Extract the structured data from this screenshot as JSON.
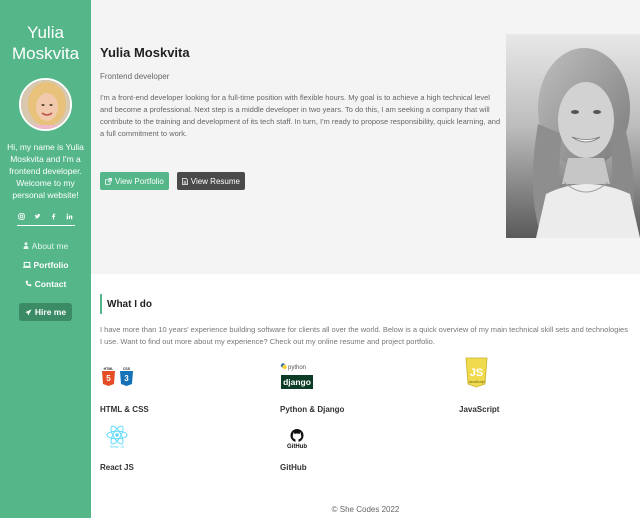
{
  "sidebar": {
    "name_line1": "Yulia",
    "name_line2": "Moskvita",
    "intro": "Hi, my name is Yulia Moskvita and I'm a frontend developer. Welcome to my personal website!",
    "social_icons": [
      "instagram-icon",
      "twitter-icon",
      "facebook-icon",
      "linkedin-icon"
    ],
    "nav": {
      "about": "About me",
      "portfolio": "Portfolio",
      "contact": "Contact"
    },
    "hire_label": "Hire me",
    "accent": "#54b689"
  },
  "hero": {
    "name": "Yulia Moskvita",
    "role": "Frontend developer",
    "bio": "I'm a front-end developer looking for a full-time position with flexible hours. My goal is to achieve a high technical level and become a professional. Next step is a middle developer in two years. To do this, I am seeking a company that will contribute to the training and development of its tech staff. In turn, I'm ready to propose responsibility, quick learning, and a full commitment to work.",
    "portfolio_btn": "View Portfolio",
    "resume_btn": "View Resume"
  },
  "whatido": {
    "title": "What I do",
    "intro": "I have more than 10 years' experience building software for clients all over the world. Below is a quick overview of my main technical skill sets and technologies I use. Want to find out more about my experience? Check out my online resume and project portfolio.",
    "skills": [
      {
        "label": "HTML & CSS",
        "html_text": "HTML",
        "css_text": "CSS"
      },
      {
        "label": "Python & Django",
        "python_text": "python",
        "django_text": "django"
      },
      {
        "label": "JavaScript",
        "js_text": "JS",
        "js_sub": "JavaScript"
      },
      {
        "label": "React JS",
        "react_text": "React JS"
      },
      {
        "label": "GitHub",
        "github_text": "GitHub"
      }
    ]
  },
  "footer": "© She Codes 2022"
}
